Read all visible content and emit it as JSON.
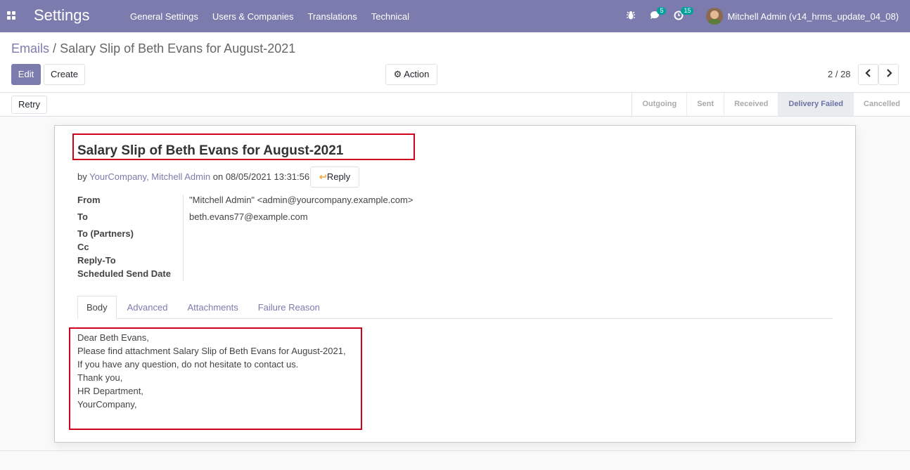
{
  "navbar": {
    "app_title": "Settings",
    "menu": [
      "General Settings",
      "Users & Companies",
      "Translations",
      "Technical"
    ],
    "messages_count": "5",
    "activities_count": "15",
    "user_name": "Mitchell Admin (v14_hrms_update_04_08)"
  },
  "breadcrumb": {
    "parent": "Emails",
    "separator": "/",
    "current": "Salary Slip of Beth Evans for August-2021"
  },
  "toolbar": {
    "edit_label": "Edit",
    "create_label": "Create",
    "action_label": "Action",
    "pager_value": "2 / 28"
  },
  "statusbar": {
    "retry_label": "Retry",
    "stages": [
      "Outgoing",
      "Sent",
      "Received",
      "Delivery Failed",
      "Cancelled"
    ],
    "active_stage": "Delivery Failed"
  },
  "email": {
    "subject": "Salary Slip of Beth Evans for August-2021",
    "by_prefix": "by",
    "author": "YourCompany, Mitchell Admin",
    "on_prefix": "on",
    "date": "08/05/2021 13:31:56",
    "reply_label": "Reply",
    "fields": [
      {
        "label": "From",
        "value": "\"Mitchell Admin\" <admin@yourcompany.example.com>"
      },
      {
        "label": "To",
        "value": "beth.evans77@example.com"
      },
      {
        "label": "To (Partners)",
        "value": ""
      },
      {
        "label": "Cc",
        "value": ""
      },
      {
        "label": "Reply-To",
        "value": ""
      },
      {
        "label": "Scheduled Send Date",
        "value": ""
      }
    ],
    "tabs": [
      "Body",
      "Advanced",
      "Attachments",
      "Failure Reason"
    ],
    "body_lines": [
      "Dear Beth Evans,",
      "Please find attachment Salary Slip of Beth Evans for August-2021,",
      "If you have any question, do not hesitate to contact us.",
      "Thank you,",
      "HR Department,",
      "YourCompany,"
    ]
  },
  "colors": {
    "brand": "#7c7bad",
    "annotation": "#d0021b",
    "badge": "#00a09d"
  }
}
